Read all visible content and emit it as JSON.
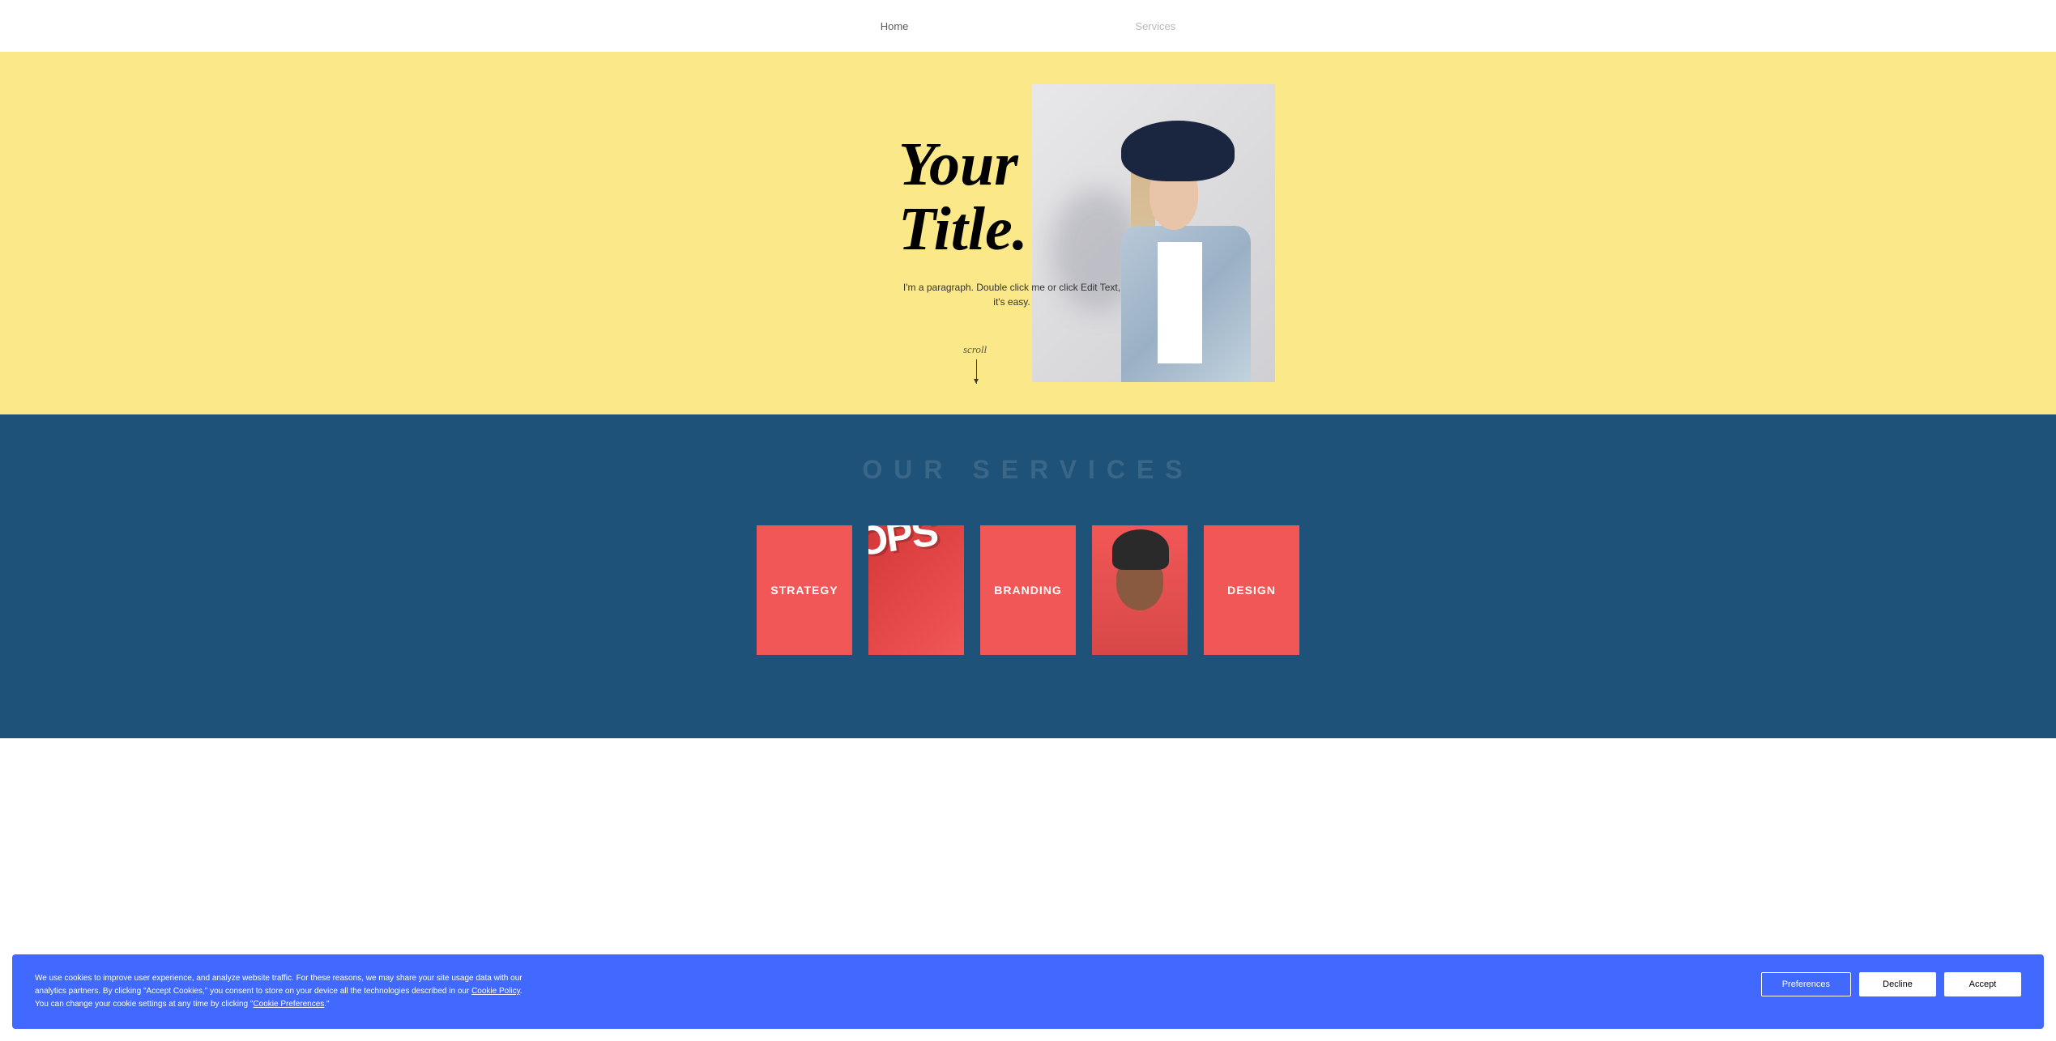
{
  "nav": {
    "items": [
      {
        "label": "Home",
        "active": true
      },
      {
        "label": "Services",
        "active": false
      }
    ]
  },
  "hero": {
    "title_line1": "Your",
    "title_line2": "Title.",
    "paragraph": "I'm a paragraph. Double click me or click Edit Text, it's easy.",
    "scroll_label": "scroll"
  },
  "services": {
    "heading": "OUR SERVICES",
    "cards": [
      {
        "label": "STRATEGY"
      },
      {
        "label": "",
        "decorative_text": "OPS"
      },
      {
        "label": "BRANDING"
      },
      {
        "label": ""
      },
      {
        "label": "DESIGN"
      }
    ]
  },
  "cookie_banner": {
    "text_part1": "We use cookies to improve user experience, and analyze website traffic. For these reasons, we may share your site usage data with our analytics partners. By clicking \"Accept Cookies,\" you consent to store on your device all the technologies described in our ",
    "link1": "Cookie Policy",
    "text_part2": ". You can change your cookie settings at any time by clicking \"",
    "link2": "Cookie Preferences",
    "text_part3": ".\"",
    "buttons": {
      "preferences": "Preferences",
      "decline": "Decline",
      "accept": "Accept"
    }
  }
}
